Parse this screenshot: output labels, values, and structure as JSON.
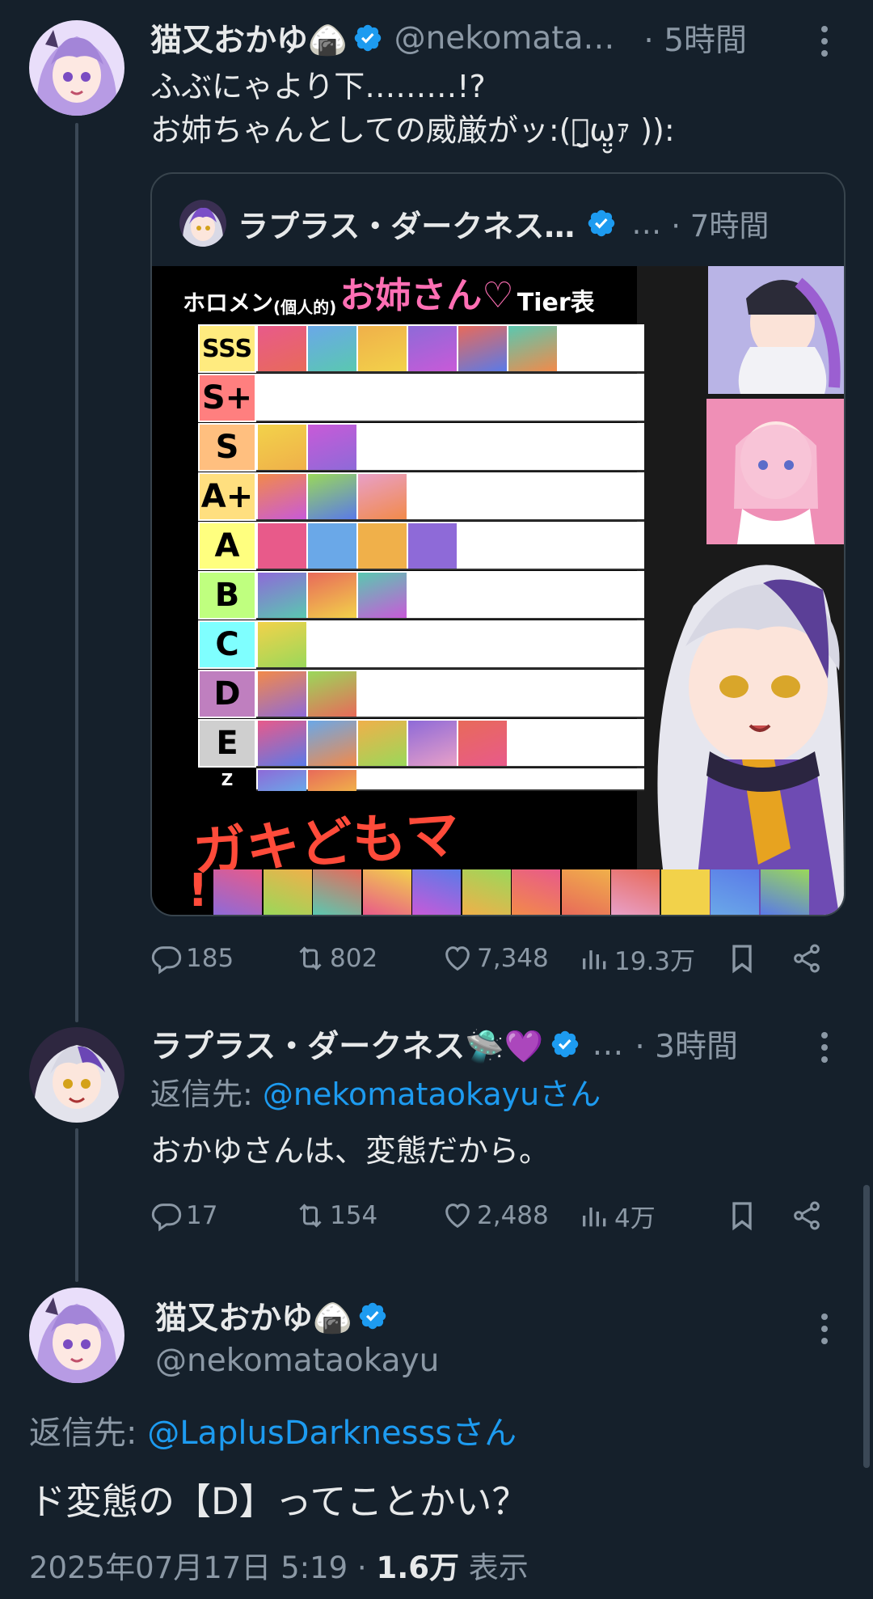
{
  "tweet1": {
    "display_name": "猫又おかゆ🍙",
    "handle": "@nekomata…",
    "time": "· 5時間",
    "text_line1": "ふぶにゃより下………!?",
    "text_line2": "お姉ちゃんとしての威厳がッ:(ｧ̤̮ω̤̮ｧ )):",
    "quote": {
      "display_name": "ラプラス・ダークネス…",
      "handle": "…",
      "time": "· 7時間",
      "image": {
        "title_prefix": "ホロメン",
        "title_paren": "(個人的)",
        "title_main": "お姉さん♡",
        "title_suffix": "Tier表",
        "tiers": [
          "SSS",
          "S+",
          "S",
          "A+",
          "A",
          "B",
          "C",
          "D",
          "E",
          "Z"
        ],
        "caption": "ガキどもマ",
        "caption2": "!"
      }
    },
    "actions": {
      "replies": "185",
      "retweets": "802",
      "likes": "7,348",
      "views": "19.3万"
    }
  },
  "tweet2": {
    "display_name": "ラプラス・ダークネス🛸💜",
    "handle": "…",
    "time": "· 3時間",
    "reply_prefix": "返信先: ",
    "reply_to": "@nekomataokayuさん",
    "text": "おかゆさんは、変態だから。",
    "actions": {
      "replies": "17",
      "retweets": "154",
      "likes": "2,488",
      "views": "4万"
    }
  },
  "tweet3": {
    "display_name": "猫又おかゆ🍙",
    "handle": "@nekomataokayu",
    "reply_prefix": "返信先: ",
    "reply_to": "@LaplusDarknesssさん",
    "text": "ド変態の【D】ってことかい？",
    "date": "2025年07月17日 5:19 · ",
    "views_count": "1.6万",
    "views_label": " 表示"
  },
  "colors": {
    "background": "#15202b",
    "link": "#1d9bf0",
    "muted": "#8b98a5",
    "verified": "#1d9bf0",
    "tier_colors": [
      "#ffeb7f",
      "#ff7f7f",
      "#ffbf7f",
      "#ffdf7f",
      "#ffff7f",
      "#bfff7f",
      "#7fffff",
      "#bf7fbf",
      "#cfcfcf",
      "#ffffff"
    ]
  }
}
